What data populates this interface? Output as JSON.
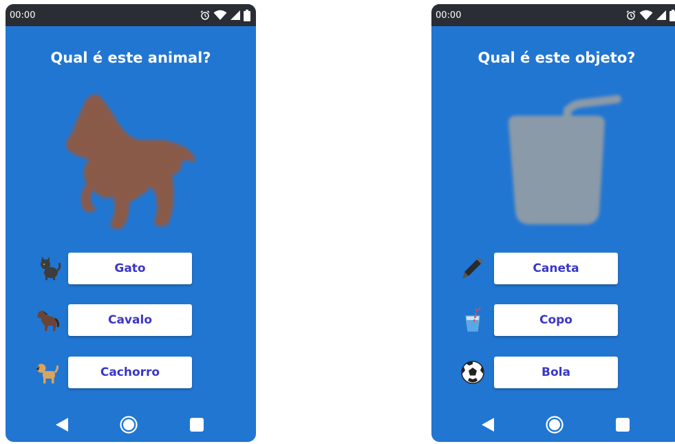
{
  "screens": [
    {
      "status": {
        "time": "00:00"
      },
      "question": "Qual é este animal?",
      "silhouette_icon": "horse-silhouette-icon",
      "options": [
        {
          "label": "Gato",
          "icon": "cat-icon"
        },
        {
          "label": "Cavalo",
          "icon": "horse-icon"
        },
        {
          "label": "Cachorro",
          "icon": "dog-icon"
        }
      ]
    },
    {
      "status": {
        "time": "00:00"
      },
      "question": "Qual é este objeto?",
      "silhouette_icon": "cup-silhouette-icon",
      "options": [
        {
          "label": "Caneta",
          "icon": "pen-icon"
        },
        {
          "label": "Copo",
          "icon": "cup-icon"
        },
        {
          "label": "Bola",
          "icon": "soccer-ball-icon"
        }
      ]
    }
  ],
  "colors": {
    "screen_background": "#2176d2",
    "status_bar": "#2a2d33",
    "button_text": "#3a36c9",
    "horse_silhouette": "#8a5a4a",
    "cup_silhouette": "#8a9aa8"
  },
  "navigation": {
    "back_icon": "back-triangle-icon",
    "home_icon": "home-circle-icon",
    "recents_icon": "recents-square-icon"
  }
}
